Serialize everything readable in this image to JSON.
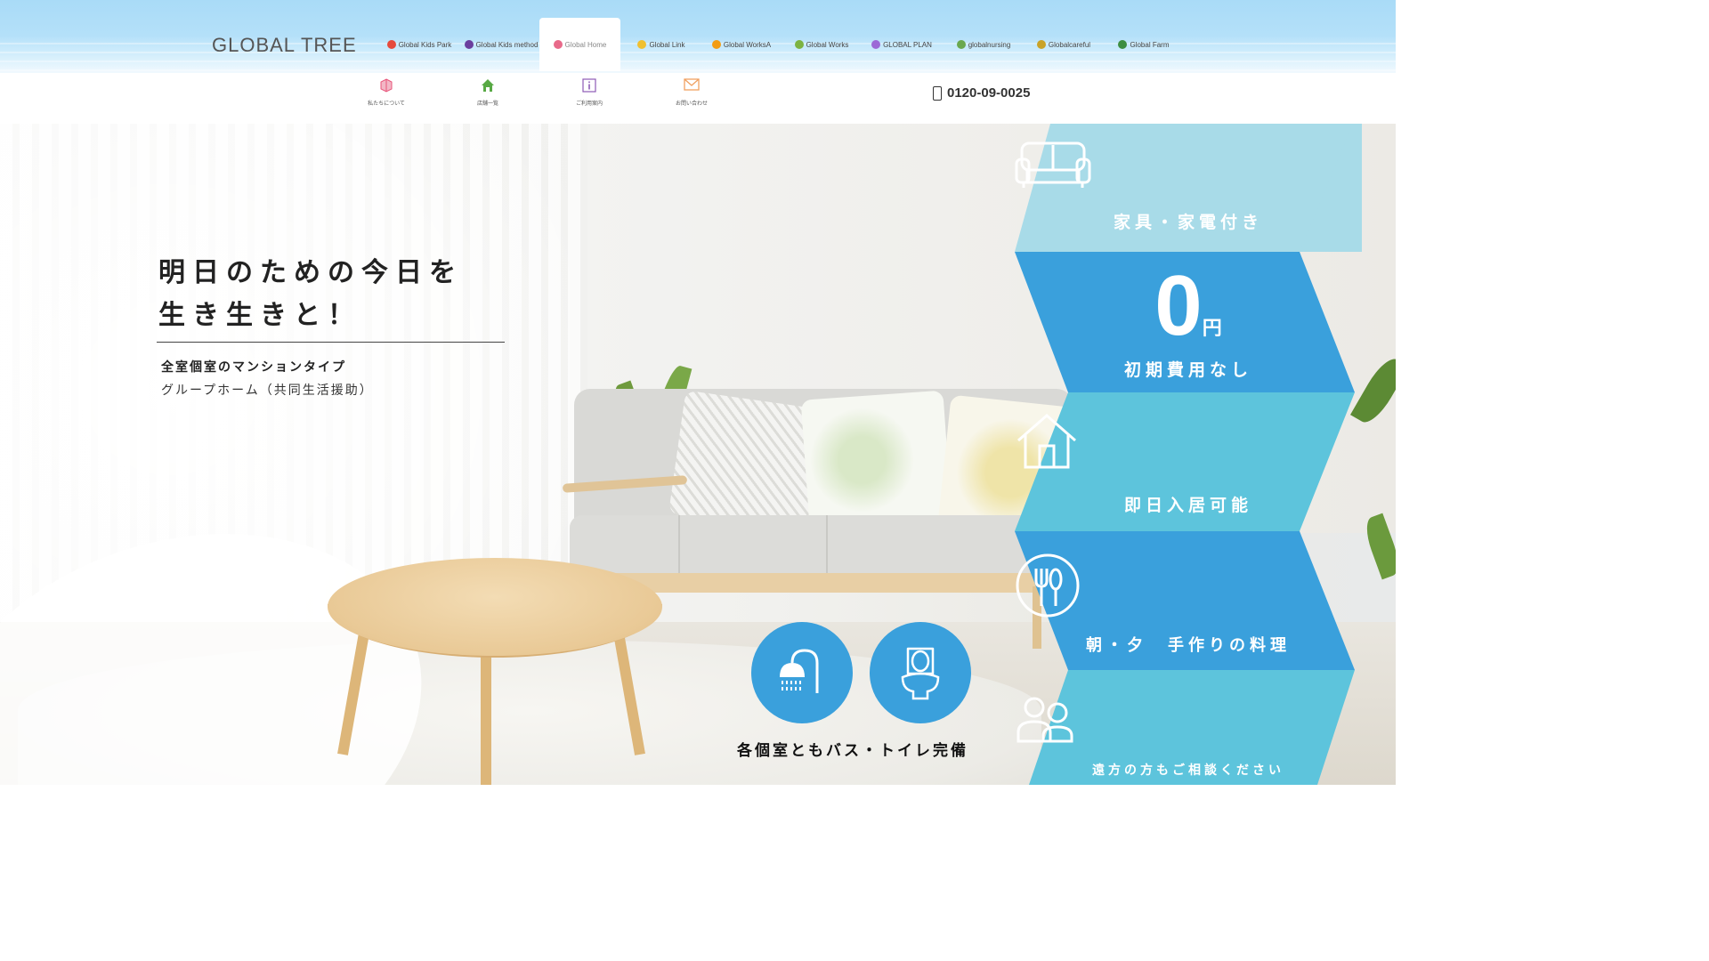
{
  "header": {
    "logo_text": "GLOBAL TREE",
    "brands": [
      {
        "label": "Global Kids Park",
        "dot": "#e64a3c"
      },
      {
        "label": "Global Kids method",
        "dot": "#6b3f9e"
      },
      {
        "label": "Global Home",
        "dot": "#e86a8a"
      },
      {
        "label": "Global Link",
        "dot": "#f0c030"
      },
      {
        "label": "Global WorksA",
        "dot": "#f39c12"
      },
      {
        "label": "Global Works",
        "dot": "#7cb342"
      },
      {
        "label": "GLOBAL PLAN",
        "dot": "#9c6ad6"
      },
      {
        "label": "globalnursing",
        "dot": "#6aa84f"
      },
      {
        "label": "Globalcareful",
        "dot": "#c9a227"
      },
      {
        "label": "Global Farm",
        "dot": "#3e8e41"
      }
    ],
    "active_brand": "Global Home"
  },
  "nav": {
    "items": [
      {
        "label": "私たちについて",
        "icon": "cube-icon",
        "color": "#e8547a"
      },
      {
        "label": "店舗一覧",
        "icon": "home-icon",
        "color": "#58a944"
      },
      {
        "label": "ご利用案内",
        "icon": "info-icon",
        "color": "#8e5bb6"
      },
      {
        "label": "お問い合わせ",
        "icon": "mail-icon",
        "color": "#f0a060"
      }
    ],
    "phone": "0120-09-0025"
  },
  "hero": {
    "headline_line1": "明日のための今日を",
    "headline_line2": "生き生きと！",
    "sub1": "全室個室のマンションタイプ",
    "sub2": "グループホーム（共同生活援助）",
    "circles_caption": "各個室ともバス・トイレ完備"
  },
  "features": [
    {
      "label": "家具・家電付き",
      "icon": "sofa-icon"
    },
    {
      "big": "0",
      "unit": "円",
      "label": "初期費用なし"
    },
    {
      "label": "即日入居可能",
      "icon": "house-icon"
    },
    {
      "label": "朝・夕　手作りの料理",
      "icon": "cutlery-icon"
    },
    {
      "label": "遠方の方もご相談ください",
      "icon": "people-icon"
    }
  ],
  "colors": {
    "light_blue": "#a8dbe8",
    "mid_blue": "#3aa0dc",
    "teal": "#5dc4dc",
    "circle_blue": "#3aa0dc"
  }
}
